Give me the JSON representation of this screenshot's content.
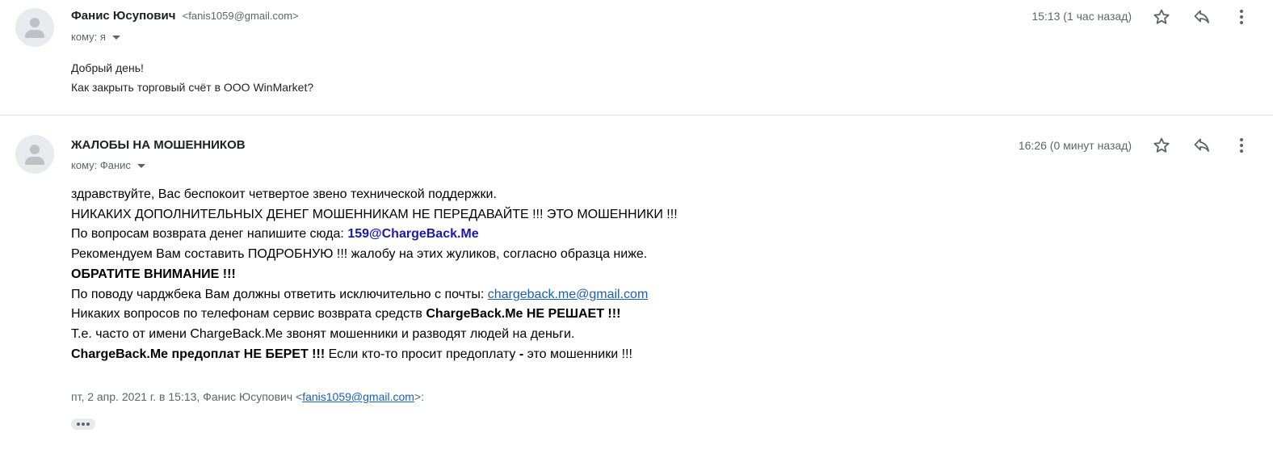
{
  "messages": [
    {
      "sender_name": "Фанис Юсупович",
      "sender_email": "<fanis1059@gmail.com>",
      "to": "кому: я",
      "timestamp": "15:13 (1 час назад)",
      "body_lines": [
        "Добрый день!",
        "Как закрыть торговый счёт в ООО WinMarket?"
      ]
    },
    {
      "sender_name": "ЖАЛОБЫ НА МОШЕННИКОВ",
      "to": "кому: Фанис",
      "timestamp": "16:26 (0 минут назад)",
      "body": {
        "line1": "здравствуйте, Вас беспокоит четвертое звено технической поддержки.",
        "line2": "НИКАКИХ ДОПОЛНИТЕЛЬНЫХ ДЕНЕГ МОШЕННИКАМ НЕ ПЕРЕДАВАЙТЕ !!! ЭТО МОШЕННИКИ !!!",
        "line3_text": "По вопросам возврата денег напишите сюда: ",
        "line3_link": "159@ChargeBack.Me",
        "line4": "Рекомендуем Вам составить ПОДРОБНУЮ !!! жалобу на этих жуликов, согласно образца ниже.",
        "line5": "ОБРАТИТЕ ВНИМАНИЕ !!!",
        "line6_text": "По поводу чарджбека Вам должны ответить исключительно с почты: ",
        "line6_link": "chargeback.me@gmail.com",
        "line7_text": "Никаких вопросов по телефонам сервис возврата средств ",
        "line7_bold": "ChargeBack.Me НЕ РЕШАЕТ !!!",
        "line8": "Т.е. часто от имени ChargeBack.Me звонят мошенники и разводят людей на деньги.",
        "line9_bold1": "ChargeBack.Me предоплат НЕ БЕРЕТ !!!",
        "line9_text1": " Если кто-то просит предоплату ",
        "line9_bold2": "-",
        "line9_text2": " это мошенники !!!"
      },
      "quote_header_text": "пт, 2 апр. 2021 г. в 15:13, Фанис Юсупович <",
      "quote_header_link": "fanis1059@gmail.com",
      "quote_header_end": ">:"
    }
  ],
  "icons": {
    "avatar": "person-avatar-icon",
    "star": "star-outline-icon",
    "reply": "reply-arrow-icon",
    "more": "more-vertical-icon",
    "expand": "ellipsis-expand-icon"
  },
  "colors": {
    "link_blue": "#1a5fb4",
    "bold_blue": "#1a1aa6",
    "muted_text": "#5f6368"
  }
}
